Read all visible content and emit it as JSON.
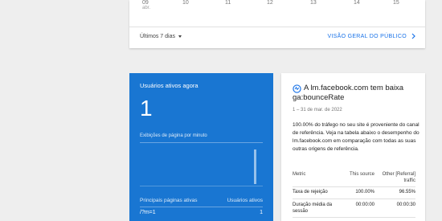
{
  "top_card": {
    "days": [
      {
        "num": "09",
        "sub": "abr."
      },
      {
        "num": "10",
        "sub": ""
      },
      {
        "num": "11",
        "sub": ""
      },
      {
        "num": "12",
        "sub": ""
      },
      {
        "num": "13",
        "sub": ""
      },
      {
        "num": "14",
        "sub": ""
      },
      {
        "num": "15",
        "sub": ""
      }
    ],
    "period_label": "Últimos 7 dias",
    "audience_link": "VISÃO GERAL DO PÚBLICO"
  },
  "realtime": {
    "title": "Usuários ativos agora",
    "active_count": "1",
    "pageviews_label": "Exibições de página por minuto",
    "top_pages_header": "Principais páginas ativas",
    "active_users_header": "Usuários ativos",
    "rows": [
      {
        "page": "/?m=1",
        "users": "1"
      }
    ]
  },
  "insight": {
    "title": "A lm.facebook.com tem baixa ga:bounceRate",
    "date": "1 – 31 de mar. de 2022",
    "description": "100.00% do tráfego no seu site é proveniente do canal de referência. Veja na tabela abaixo o desempenho do lm.facebook.com em comparação com todas as suas outras origens de referência.",
    "table": {
      "headers": [
        "Metric",
        "This source",
        "Other [Referral] traffic"
      ],
      "rows": [
        {
          "metric": "Taxa de rejeição",
          "this": "100.00%",
          "other": "96.55%"
        },
        {
          "metric": "Duração média da sessão",
          "this": "00:00:00",
          "other": "00:00:30"
        }
      ]
    }
  },
  "colors": {
    "accent": "#1a73e8",
    "realtime_card": "#1976d2",
    "background": "#eeeeee"
  }
}
